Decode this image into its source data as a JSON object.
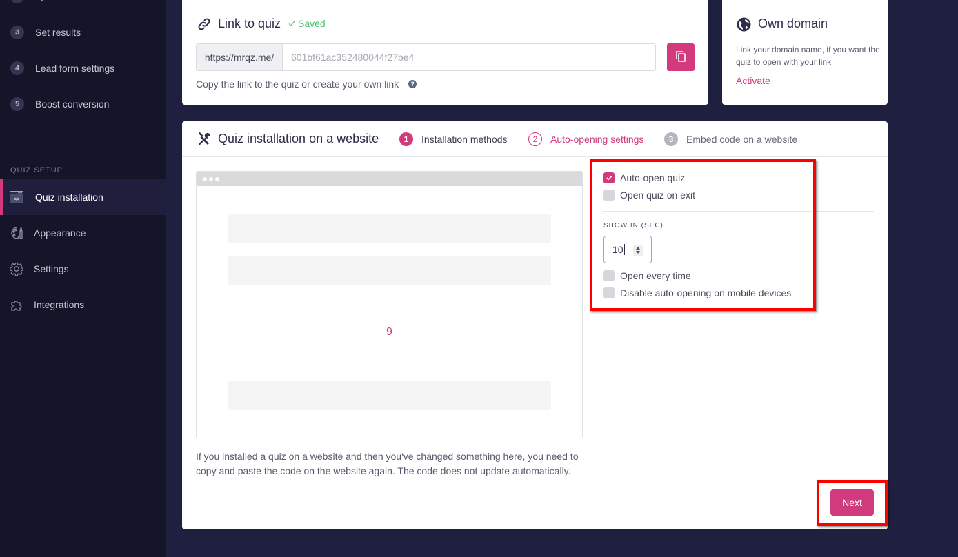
{
  "sidebar": {
    "steps": [
      {
        "num": "3",
        "label": "Set results"
      },
      {
        "num": "4",
        "label": "Lead form settings"
      },
      {
        "num": "5",
        "label": "Boost conversion"
      }
    ],
    "section_label": "QUIZ SETUP",
    "nav": [
      {
        "label": "Quiz installation",
        "icon": "code-window-icon",
        "active": true
      },
      {
        "label": "Appearance",
        "icon": "palette-icon"
      },
      {
        "label": "Settings",
        "icon": "gear-icon"
      },
      {
        "label": "Integrations",
        "icon": "puzzle-icon"
      }
    ]
  },
  "link_card": {
    "title": "Link to quiz",
    "saved_label": "Saved",
    "url_prefix": "https://mrqz.me/",
    "url_value": "601bf61ac352480044f27be4",
    "hint": "Copy the link to the quiz or create your own link",
    "help_glyph": "?"
  },
  "domain_card": {
    "title": "Own domain",
    "description": "Link your domain name, if you want the quiz to open with your link",
    "activate_label": "Activate"
  },
  "install_card": {
    "title": "Quiz installation on a website",
    "tabs": [
      {
        "num": "1",
        "label": "Installation methods",
        "state": "completed"
      },
      {
        "num": "2",
        "label": "Auto-opening settings",
        "state": "active"
      },
      {
        "num": "3",
        "label": "Embed code on a website",
        "state": "pending"
      }
    ],
    "preview_countdown": "9",
    "notice": "If you installed a quiz on a website and then you've changed something here, you need to copy and paste the code on the website again. The code does not update automatically.",
    "options": {
      "auto_open": {
        "label": "Auto-open quiz",
        "checked": true
      },
      "open_on_exit": {
        "label": "Open quiz on exit",
        "checked": false
      },
      "show_in_label": "SHOW IN (SEC)",
      "show_in_value": "10",
      "open_every_time": {
        "label": "Open every time",
        "checked": false
      },
      "disable_mobile": {
        "label": "Disable auto-opening on mobile devices",
        "checked": false
      }
    },
    "next_label": "Next"
  },
  "colors": {
    "accent": "#d13a7c",
    "sidebar_bg": "#15152a",
    "page_bg": "#1f1f3f",
    "saved_green": "#4cbf73",
    "highlight_red": "#ff0000"
  }
}
